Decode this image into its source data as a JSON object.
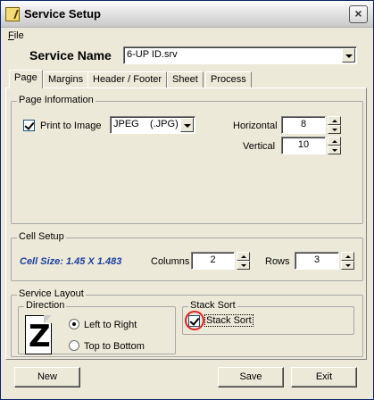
{
  "window": {
    "title": "Service Setup",
    "close_label": "×"
  },
  "menu": {
    "file_first": "F",
    "file_rest": "ile"
  },
  "service": {
    "label": "Service Name",
    "value": "6-UP ID.srv"
  },
  "tabs": [
    {
      "label": "Page",
      "active": true
    },
    {
      "label": "Margins"
    },
    {
      "label": "Header / Footer"
    },
    {
      "label": "Sheet"
    },
    {
      "label": "Process"
    }
  ],
  "page_info": {
    "title": "Page Information",
    "print_to_image_label": "Print to Image",
    "print_to_image_checked": true,
    "image_format": "JPEG    (.JPG)",
    "horizontal_label": "Horizontal",
    "horizontal_value": "8",
    "vertical_label": "Vertical",
    "vertical_value": "10"
  },
  "cell_setup": {
    "title": "Cell Setup",
    "cell_size": "Cell Size: 1.45 X 1.483",
    "columns_label": "Columns",
    "columns_value": "2",
    "rows_label": "Rows",
    "rows_value": "3"
  },
  "service_layout": {
    "title": "Service Layout",
    "direction_title": "Direction",
    "left_to_right": "Left to Right",
    "top_to_bottom": "Top to Bottom",
    "selected_direction": "left_to_right",
    "stack_sort_title": "Stack Sort",
    "stack_sort_label": "Stack Sort",
    "stack_sort_checked": true
  },
  "buttons": {
    "new": "New",
    "save": "Save",
    "exit": "Exit"
  },
  "colors": {
    "cell_size_text": "#1b3fa0",
    "highlight_ring": "#e02020"
  }
}
